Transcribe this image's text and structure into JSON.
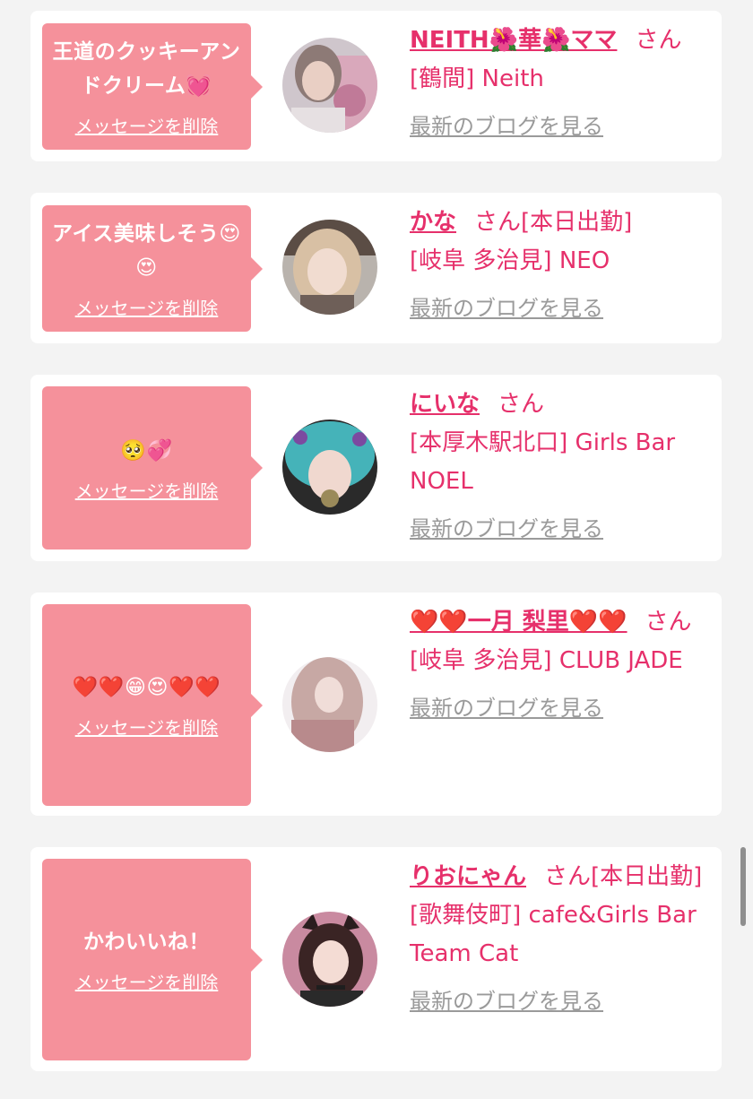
{
  "delete_label": "メッセージを削除",
  "blog_label": "最新のブログを見る",
  "san_label": "さん",
  "colors": {
    "accent": "#e6306b",
    "bubble": "#f5919b",
    "muted": "#9a9a9a",
    "background": "#f3f3f3"
  },
  "cards": [
    {
      "message": "王道のクッキーアンドクリーム💓",
      "name": "NEITH🌺華🌺ママ",
      "san": "さん",
      "shop": "[鶴間] Neith"
    },
    {
      "message": "アイス美味しそう😍😍",
      "name": "かな",
      "san": "さん[本日出勤]",
      "shop": "[岐阜 多治見] NEO"
    },
    {
      "message": "🥺💞",
      "name": "にいな",
      "san": "さん",
      "shop": "[本厚木駅北口] Girls Bar NOEL"
    },
    {
      "message": "❤️❤️😁😍❤️❤️",
      "name": "❤️❤️一月 梨里❤️❤️",
      "san": "さん",
      "shop": "[岐阜 多治見] CLUB JADE"
    },
    {
      "message": "かわいいね！",
      "name": "りおにゃん",
      "san": "さん[本日出勤]",
      "shop": "[歌舞伎町] cafe&Girls Bar Team Cat"
    }
  ]
}
